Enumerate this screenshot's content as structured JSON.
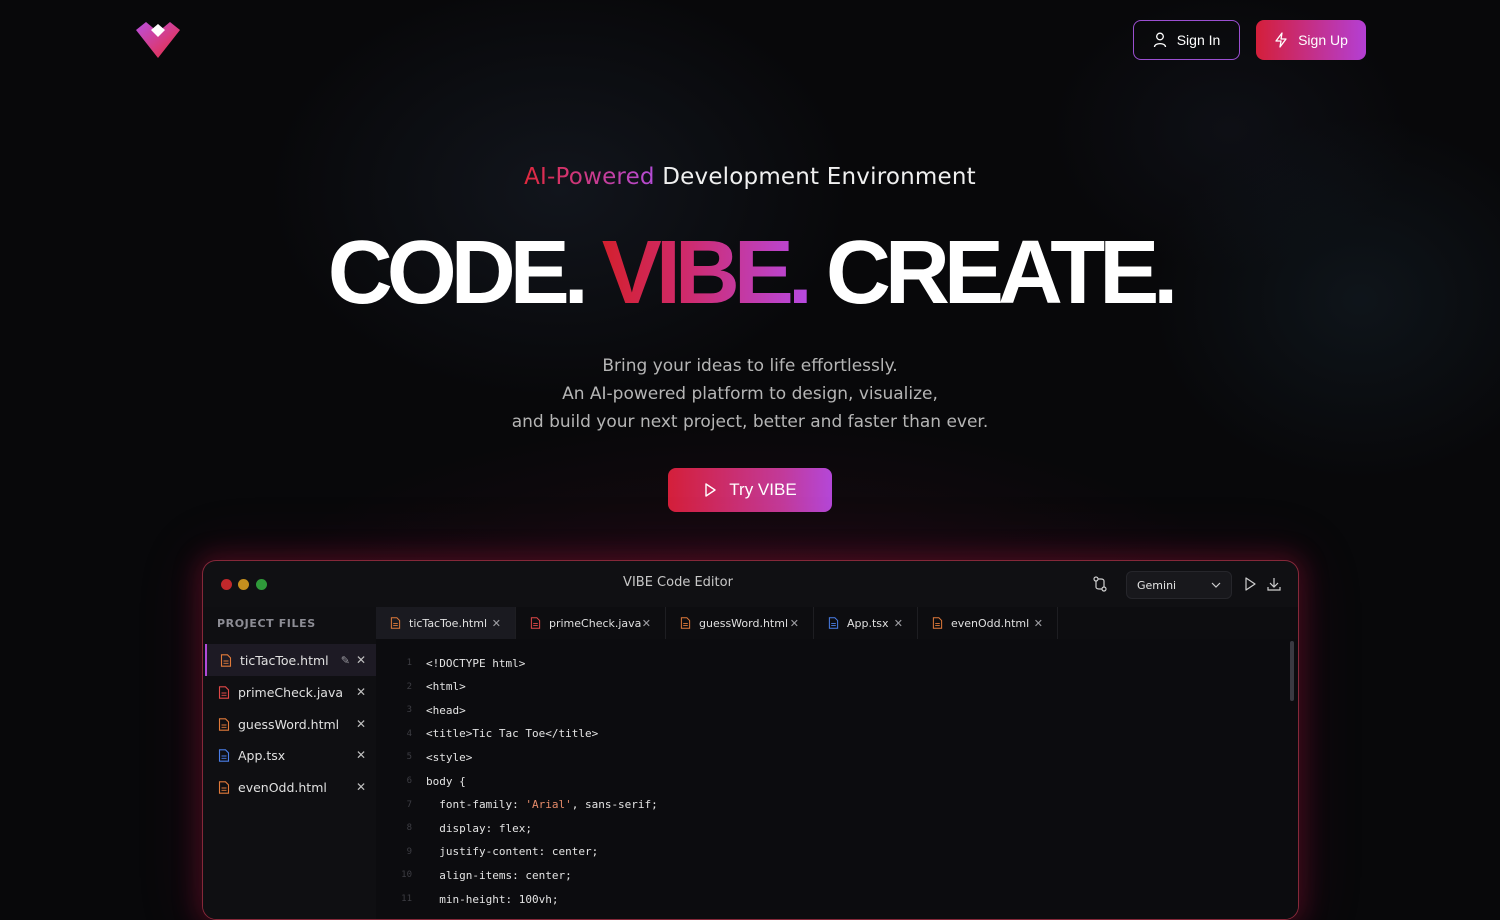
{
  "header": {
    "logo": "vibe-heart-logo",
    "sign_in_label": "Sign In",
    "sign_up_label": "Sign Up"
  },
  "hero": {
    "eyebrow_accent": "AI-Powered",
    "eyebrow_rest": " Development Environment",
    "headline_1": "CODE.",
    "headline_2": "VIBE.",
    "headline_3": "CREATE.",
    "sub_line_1": "Bring your ideas to life effortlessly.",
    "sub_line_2": "An AI-powered platform to design, visualize,",
    "sub_line_3": "and build your next project, better and faster than ever.",
    "cta_label": "Try VIBE"
  },
  "editor": {
    "title": "VIBE Code Editor",
    "model": "Gemini",
    "sidebar_title": "PROJECT FILES",
    "files": [
      {
        "name": "ticTacToe.html",
        "type": "html",
        "active": true
      },
      {
        "name": "primeCheck.java",
        "type": "java",
        "active": false
      },
      {
        "name": "guessWord.html",
        "type": "html",
        "active": false
      },
      {
        "name": "App.tsx",
        "type": "tsx",
        "active": false
      },
      {
        "name": "evenOdd.html",
        "type": "html",
        "active": false
      }
    ],
    "tabs": [
      {
        "name": "ticTacToe.html",
        "type": "html",
        "active": true
      },
      {
        "name": "primeCheck.java",
        "type": "java",
        "active": false
      },
      {
        "name": "guessWord.html",
        "type": "html",
        "active": false
      },
      {
        "name": "App.tsx",
        "type": "tsx",
        "active": false
      },
      {
        "name": "evenOdd.html",
        "type": "html",
        "active": false
      }
    ],
    "code_lines": [
      {
        "n": "1",
        "text": "<!DOCTYPE html>"
      },
      {
        "n": "2",
        "text": "<html>"
      },
      {
        "n": "3",
        "text": "<head>"
      },
      {
        "n": "4",
        "text": "<title>Tic Tac Toe</title>"
      },
      {
        "n": "5",
        "text": "<style>"
      },
      {
        "n": "6",
        "text": "body {"
      },
      {
        "n": "7",
        "text": "  font-family: 'Arial', sans-serif;"
      },
      {
        "n": "8",
        "text": "  display: flex;"
      },
      {
        "n": "9",
        "text": "  justify-content: center;"
      },
      {
        "n": "10",
        "text": "  align-items: center;"
      },
      {
        "n": "11",
        "text": "  min-height: 100vh;"
      }
    ]
  },
  "colors": {
    "accent_red": "#d41f3a",
    "accent_purple": "#b447d8",
    "background": "#08080a"
  }
}
